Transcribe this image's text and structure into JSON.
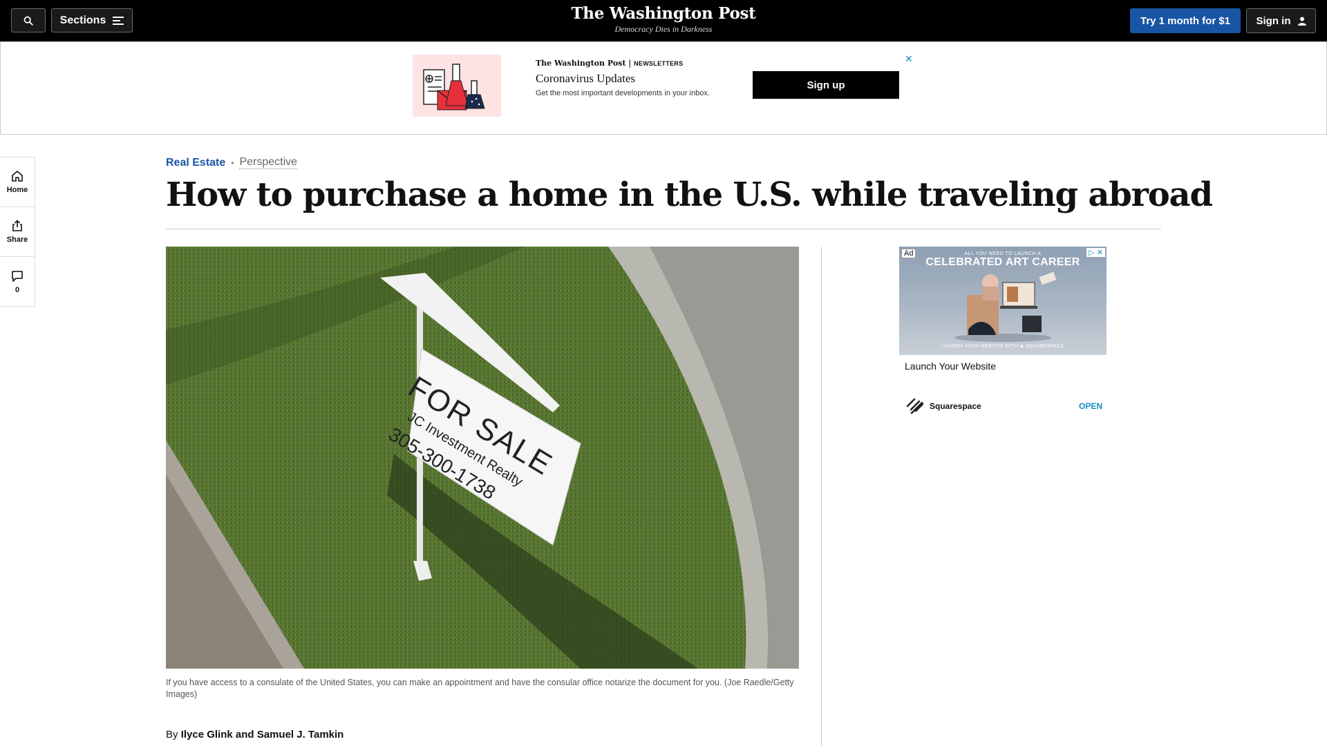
{
  "header": {
    "sections_label": "Sections",
    "logo": "The Washington Post",
    "tagline": "Democracy Dies in Darkness",
    "subscribe_label": "Try 1 month for $1",
    "signin_label": "Sign in"
  },
  "newsletter_ad": {
    "brand": "The Washington Post",
    "brand_suffix": "NEWSLETTERS",
    "title": "Coronavirus Updates",
    "description": "Get the most important developments in your inbox.",
    "signup_label": "Sign up",
    "close_icon": "✕"
  },
  "rail": {
    "home_label": "Home",
    "share_label": "Share",
    "comments_count": "0"
  },
  "article": {
    "section": "Real Estate",
    "separator": "•",
    "label": "Perspective",
    "headline": "How to purchase a home in the U.S. while traveling abroad",
    "photo_sign": {
      "line1": "FOR SALE",
      "line2": "JC Investment Realty",
      "line3": "305-300-1738"
    },
    "caption": "If you have access to a consulate of the United States, you can make an appointment and have the consular office notarize the document for you. (Joe Raedle/Getty Images)",
    "byline_prefix": "By",
    "authors": "Ilyce Glink and Samuel J. Tamkin"
  },
  "side_ad": {
    "badge": "Ad",
    "close_icon": "✕",
    "kicker": "ALL YOU NEED TO LAUNCH A",
    "headline": "CELEBRATED ART CAREER",
    "footer": "LAUNCH YOUR WEBSITE WITH ◈ SQUARESPACE",
    "title": "Launch Your Website",
    "brand": "Squarespace",
    "cta": "OPEN"
  }
}
